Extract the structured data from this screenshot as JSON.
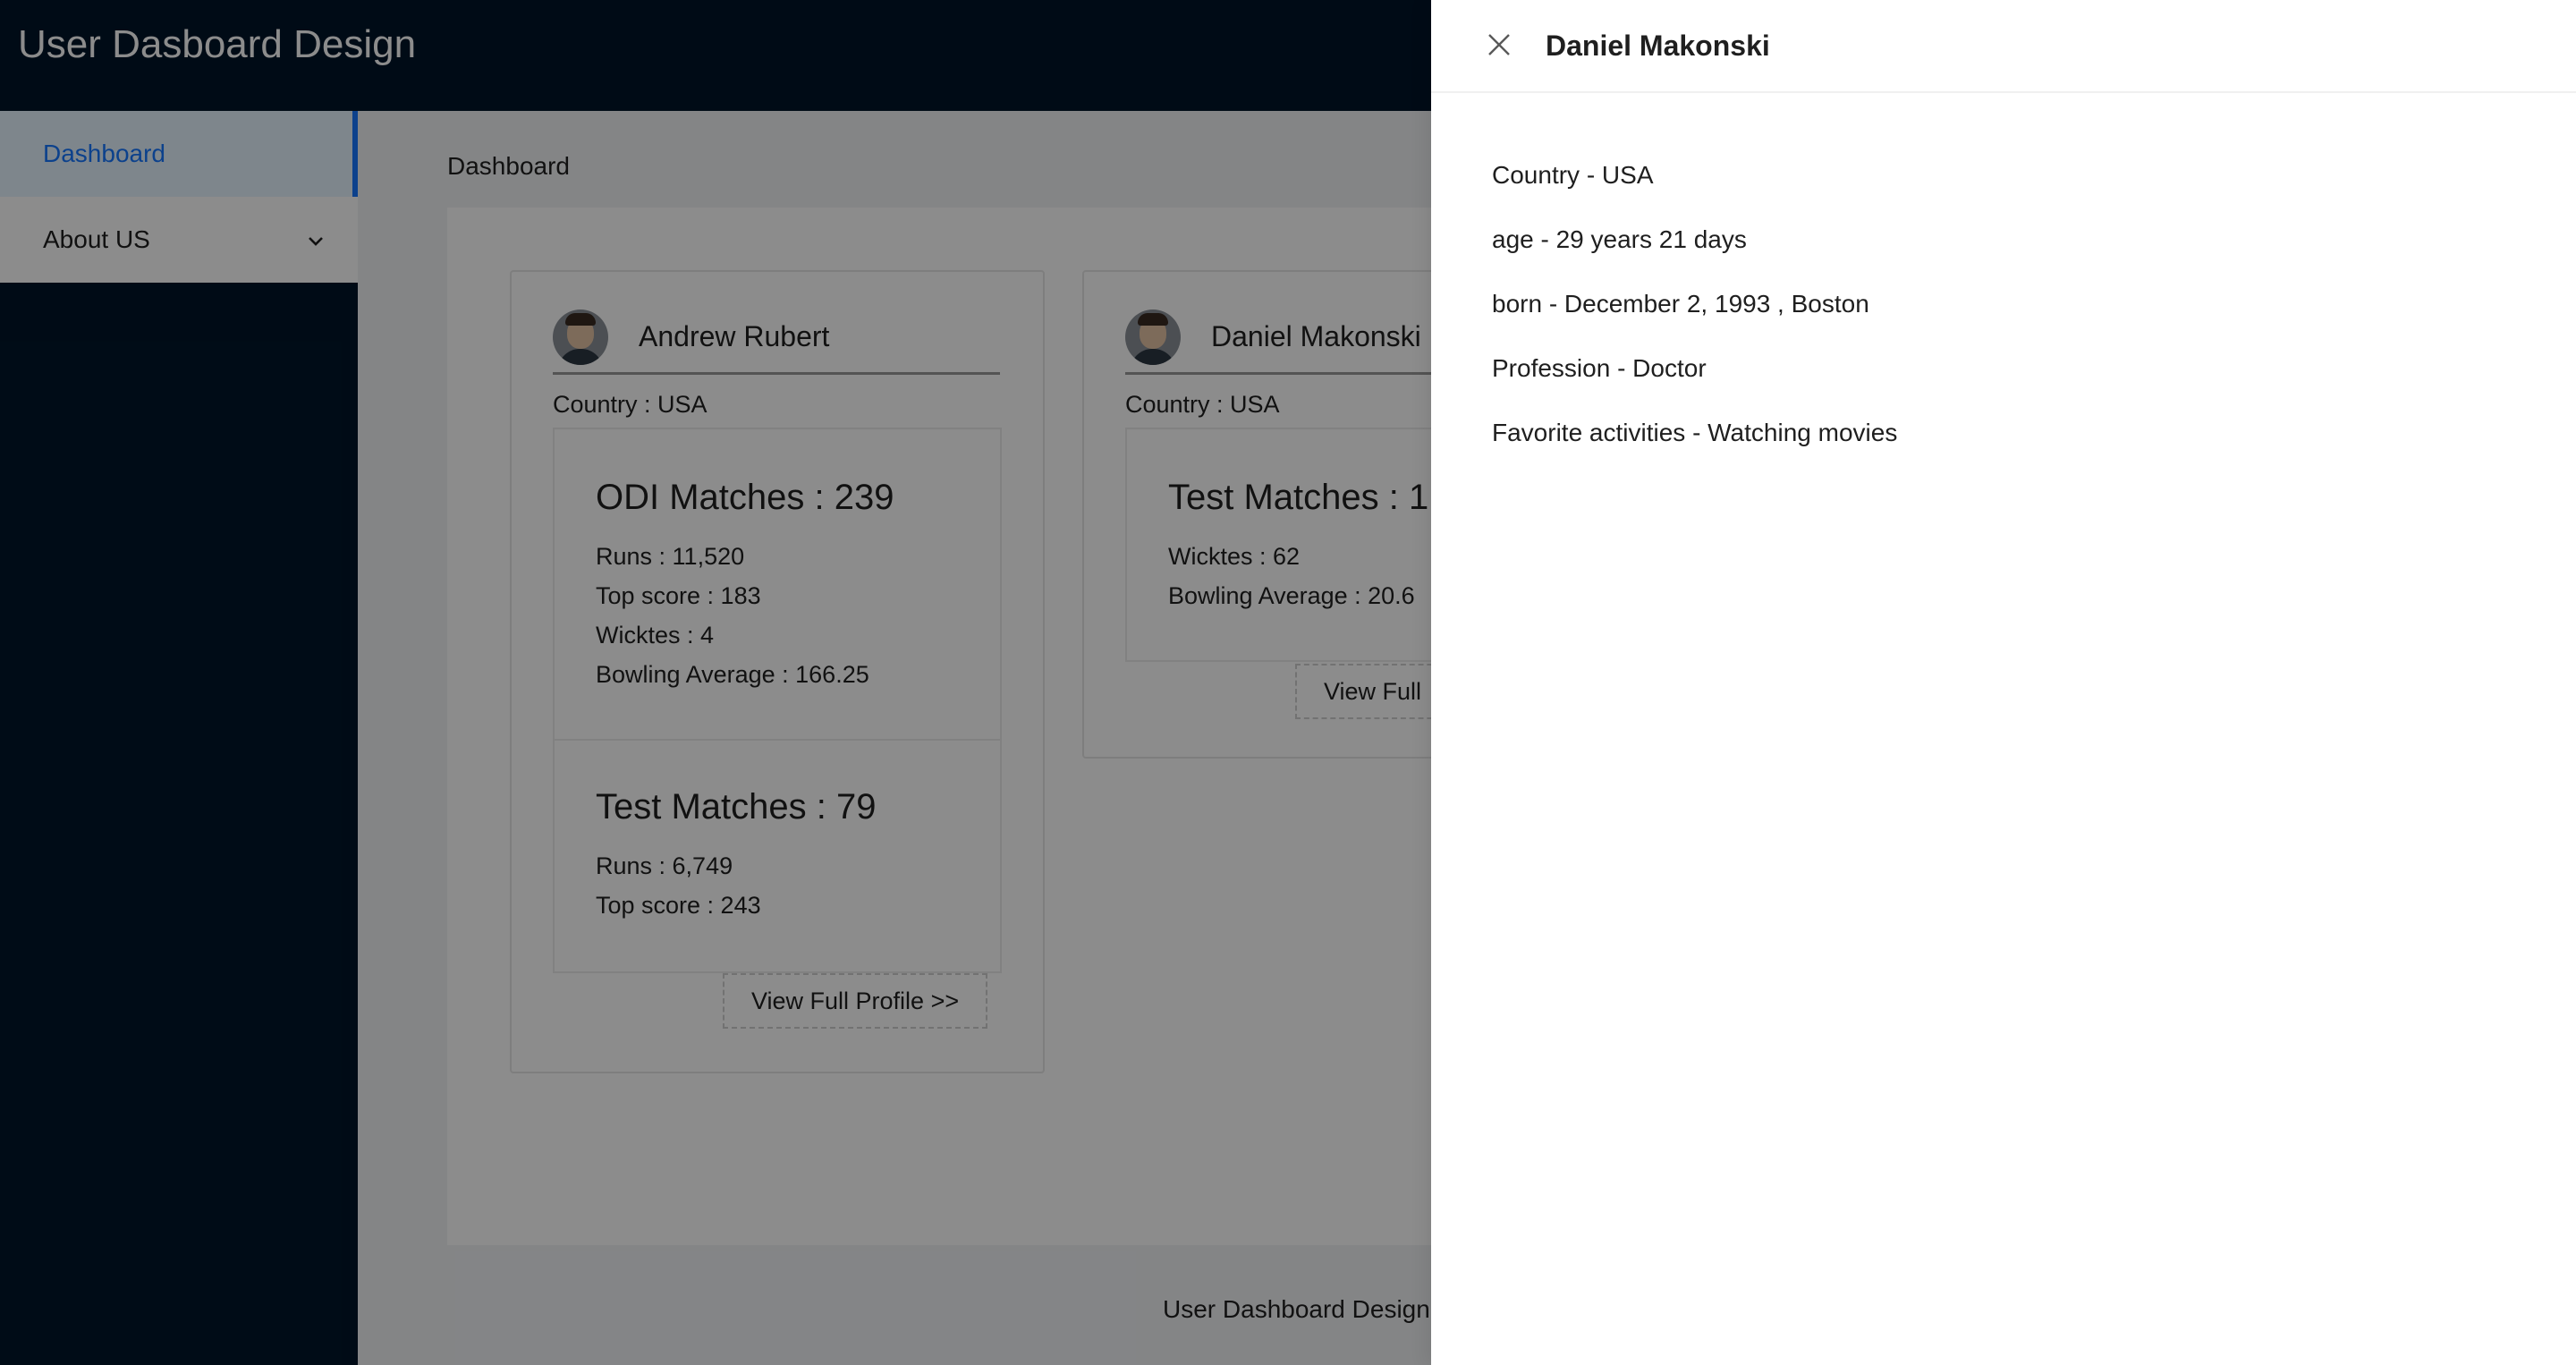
{
  "app": {
    "title": "User Dasboard Design"
  },
  "sidebar": {
    "items": [
      {
        "label": "Dashboard"
      },
      {
        "label": "About US"
      }
    ]
  },
  "breadcrumb": "Dashboard",
  "cards": [
    {
      "name": "Andrew Rubert",
      "country": "Country : USA",
      "odi": {
        "title": "ODI Matches : 239",
        "lines": [
          "Runs : 11,520",
          "Top score : 183",
          "Wicktes : 4",
          "Bowling Average : 166.25"
        ]
      },
      "test": {
        "title": "Test Matches : 79",
        "lines": [
          "Runs : 6,749",
          "Top score : 243"
        ]
      },
      "view_button": "View Full Profile >>"
    },
    {
      "name": "Daniel Makonski",
      "country": "Country : USA",
      "test": {
        "title": "Test Matches : 1",
        "lines": [
          "Wicktes : 62",
          "Bowling Average : 20.6"
        ]
      },
      "view_button": "View Full"
    }
  ],
  "footer": {
    "text": "User Dashboard Design"
  },
  "drawer": {
    "title": "Daniel Makonski",
    "lines": [
      "Country - USA",
      "age - 29 years 21 days",
      "born - December 2, 1993 , Boston",
      "Profession - Doctor",
      "Favorite activities - Watching movies"
    ]
  }
}
